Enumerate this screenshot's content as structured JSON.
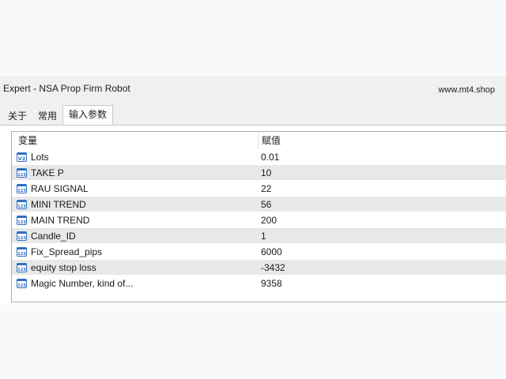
{
  "window": {
    "title": "Expert - NSA Prop Firm Robot",
    "watermark": "www.mt4.shop"
  },
  "tabs": [
    {
      "label": "关于",
      "active": false
    },
    {
      "label": "常用",
      "active": false
    },
    {
      "label": "输入参数",
      "active": true
    }
  ],
  "table": {
    "columns": {
      "name": "变量",
      "value": "赋值"
    },
    "rows": [
      {
        "name": "Lots",
        "value": "0.01",
        "icon": "double-value-icon"
      },
      {
        "name": "TAKE P",
        "value": "10",
        "icon": "integer-value-icon"
      },
      {
        "name": "RAU SIGNAL",
        "value": "22",
        "icon": "integer-value-icon"
      },
      {
        "name": "MINI TREND",
        "value": "56",
        "icon": "integer-value-icon"
      },
      {
        "name": "MAIN TREND",
        "value": "200",
        "icon": "integer-value-icon"
      },
      {
        "name": "Candle_ID",
        "value": "1",
        "icon": "integer-value-icon"
      },
      {
        "name": "Fix_Spread_pips",
        "value": "6000",
        "icon": "integer-value-icon"
      },
      {
        "name": "equity stop loss",
        "value": "-3432",
        "icon": "integer-value-icon"
      },
      {
        "name": "Magic Number, kind of...",
        "value": "9358",
        "icon": "integer-value-icon"
      }
    ]
  },
  "icons": {
    "double_label": "V2",
    "integer_label": "123"
  },
  "colors": {
    "alt_row": "#e8e8e8",
    "icon_blue": "#2f6fc0"
  }
}
